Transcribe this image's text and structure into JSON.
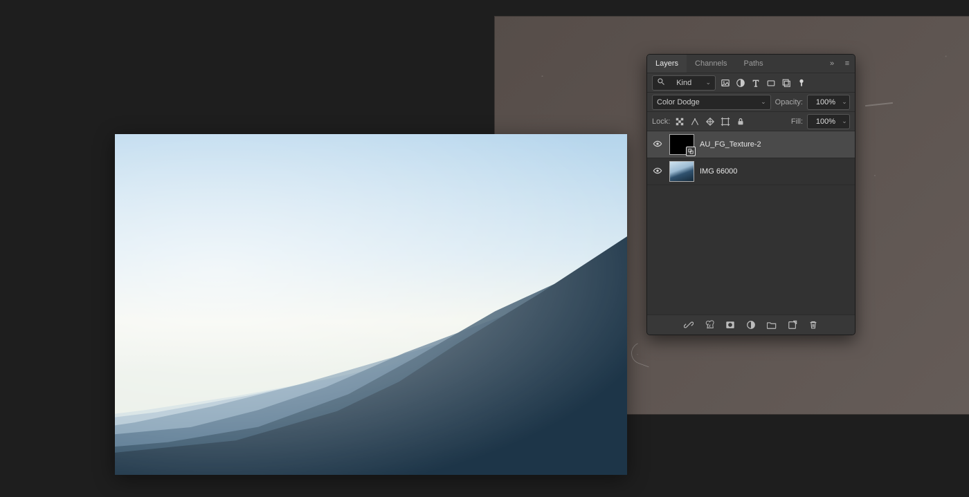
{
  "panel": {
    "tabs": {
      "layers": "Layers",
      "channels": "Channels",
      "paths": "Paths"
    },
    "kind_filter": "Kind",
    "blend_mode": "Color Dodge",
    "opacity_label": "Opacity:",
    "opacity_value": "100%",
    "lock_label": "Lock:",
    "fill_label": "Fill:",
    "fill_value": "100%",
    "layers": [
      {
        "name": "AU_FG_Texture-2",
        "smart_object": true,
        "selected": true
      },
      {
        "name": "IMG 66000",
        "smart_object": false,
        "selected": false
      }
    ]
  }
}
